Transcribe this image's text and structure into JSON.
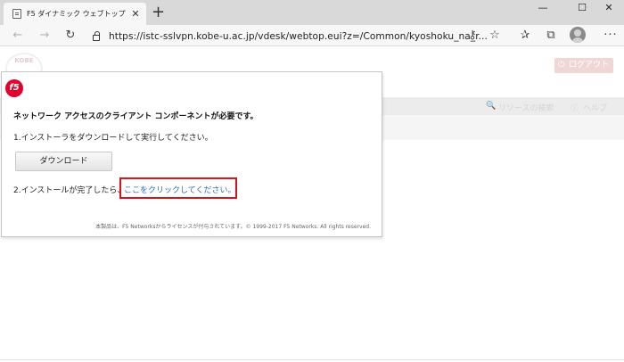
{
  "browser": {
    "tab_title": "F5 ダイナミック ウェブトップ",
    "tab_close": "✕",
    "new_tab": "+",
    "window_controls": {
      "minimize": "—",
      "maximize": "☐",
      "close": "✕"
    },
    "url": "https://istc-sslvpn.kobe-u.ac.jp/vdesk/webtop.eui?z=/Common/kyoshoku_na_r...",
    "icons": [
      "back-icon",
      "forward-icon",
      "refresh-icon",
      "lock-icon",
      "key-icon",
      "star-icon",
      "favorites-icon",
      "collections-icon",
      "profile-icon",
      "more-icon"
    ]
  },
  "page": {
    "logo_text": "KOBE",
    "logout_label": "ログアウト",
    "search_resources": "リソースの検索",
    "help_label": "ヘルプ"
  },
  "dialog": {
    "logo": "f5",
    "title": "ネットワーク アクセスのクライアント コンポーネントが必要です。",
    "step1": "1.インストーラをダウンロードして実行してください。",
    "download_label": "ダウンロード",
    "step2_prefix": "2.インストールが完了したら、",
    "step2_link": "ここをクリックしてください。",
    "footer": "本製品は、F5 Networksからライセンスが付与されています。© 1999-2017 F5 Networks. All rights reserved."
  },
  "colors": {
    "f5_red": "#e4002b",
    "highlight_border": "#d9141f",
    "link": "#2b6cc4"
  }
}
